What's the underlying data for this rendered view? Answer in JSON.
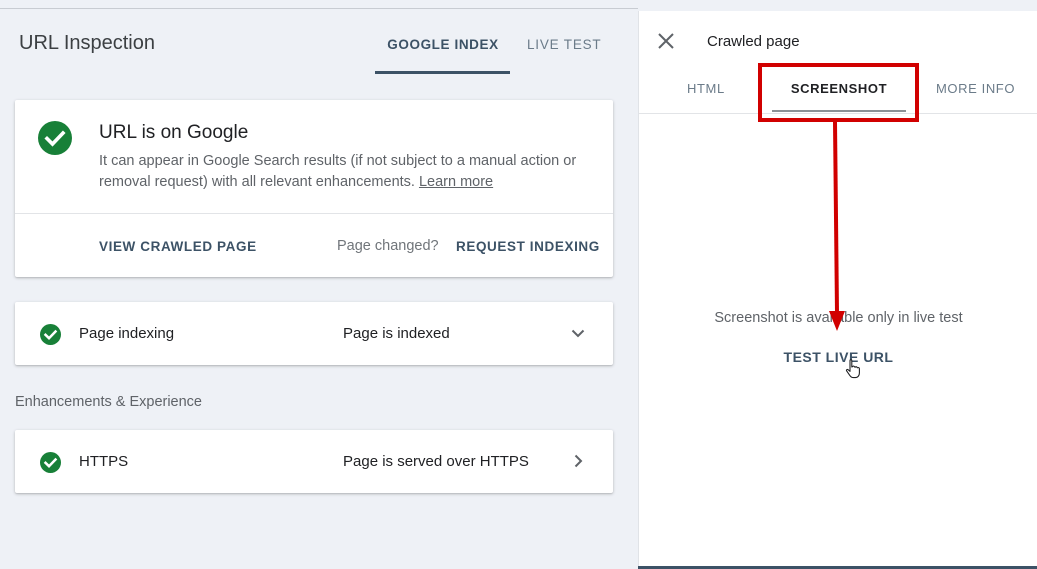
{
  "header": {
    "title": "URL Inspection",
    "tabs": [
      {
        "label": "GOOGLE INDEX",
        "active": true
      },
      {
        "label": "LIVE TEST",
        "active": false
      }
    ]
  },
  "status_card": {
    "icon": "check-circle-icon",
    "title": "URL is on Google",
    "description": "It can appear in Google Search results (if not subject to a manual action or removal request) with all relevant enhancements.",
    "learn_more": "Learn more",
    "view_crawled_page": "VIEW CRAWLED PAGE",
    "page_changed": "Page changed?",
    "request_indexing": "REQUEST INDEXING"
  },
  "page_indexing": {
    "label": "Page indexing",
    "value": "Page is indexed",
    "icon": "chevron-down-icon"
  },
  "enhancements": {
    "section_label": "Enhancements & Experience",
    "items": [
      {
        "label": "HTTPS",
        "value": "Page is served over HTTPS",
        "icon": "chevron-right-icon"
      }
    ]
  },
  "panel": {
    "title": "Crawled page",
    "tabs": [
      {
        "label": "HTML",
        "active": false
      },
      {
        "label": "SCREENSHOT",
        "active": true
      },
      {
        "label": "MORE INFO",
        "active": false
      }
    ],
    "message": "Screenshot is available only in live test",
    "test_live_url": "TEST LIVE URL"
  },
  "colors": {
    "success": "#188038",
    "accent": "#3c5266",
    "annotation": "#d10000",
    "background": "#eef1f6"
  }
}
